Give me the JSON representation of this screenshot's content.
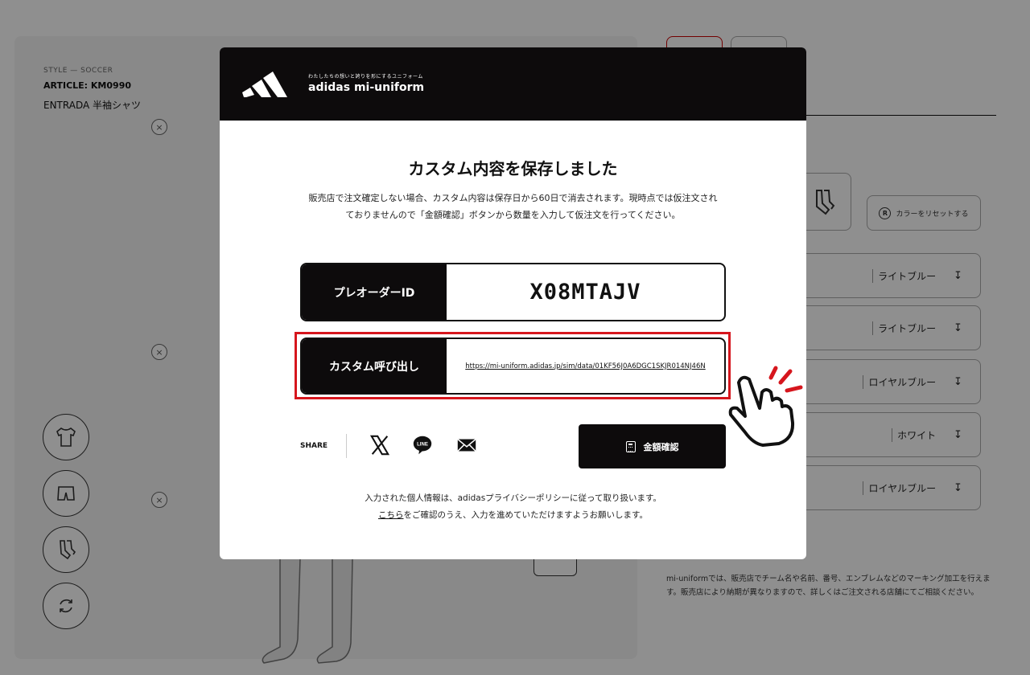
{
  "background": {
    "style_label": "STYLE — SOCCER",
    "article_label": "ARTICLE: KM0990",
    "product_name": "ENTRADA 半袖シャツ",
    "remove_icon": "×",
    "reset_color_label": "カラーをリセットする",
    "reset_icon_glyph": "R",
    "color_rows": [
      {
        "value": "ライトブルー",
        "arrow": "↧"
      },
      {
        "value": "ライトブルー",
        "arrow": "↧"
      },
      {
        "value": "ロイヤルブルー",
        "arrow": "↧"
      },
      {
        "value": "ホワイト",
        "arrow": "↧"
      },
      {
        "value": "ロイヤルブルー",
        "arrow": "↧"
      }
    ],
    "marking_note": "mi-uniformでは、販売店でチーム名や名前、番号、エンブレムなどのマーキング加工を行えます。販売店により納期が異なりますので、詳しくはご注文される店舗にてご相談ください。"
  },
  "modal": {
    "brand_tagline": "わたしたちの想いと誇りを形にするユニフォーム",
    "brand_name": "adidas mi-uniform",
    "title": "カスタム内容を保存しました",
    "description": "販売店で注文確定しない場合、カスタム内容は保存日から60日で消去されます。現時点では仮注文されておりませんので「金額確認」ボタンから数量を入力して仮注文を行ってください。",
    "preorder_label": "プレオーダーID",
    "preorder_id": "X08MTAJV",
    "custom_call_label": "カスタム呼び出し",
    "custom_call_url": "https://mi-uniform.adidas.jp/sim/data/01KF56J0A6DGC1SKJR014NJ46N",
    "share_label": "SHARE",
    "share_icons": [
      "x-icon",
      "line-icon",
      "mail-icon"
    ],
    "line_text": "LINE",
    "price_button_label": "金額確認",
    "privacy_line1": "入力された個人情報は、adidasプライバシーポリシーに従って取り扱います。",
    "privacy_link": "こちら",
    "privacy_line2_rest": "をご確認のうえ、入力を進めていただけますようお願いします。"
  },
  "colors": {
    "header_bg": "#0d0b0c",
    "highlight_red": "#d6161d",
    "overlay": "rgba(0,0,0,0.44)"
  }
}
